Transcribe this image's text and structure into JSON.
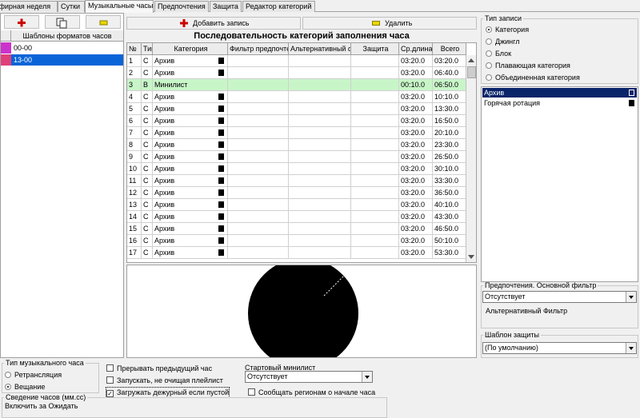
{
  "tabs": [
    {
      "label": "Эфирная неделя"
    },
    {
      "label": "Сутки"
    },
    {
      "label": "Музыкальные часы"
    },
    {
      "label": "Предпочтения"
    },
    {
      "label": "Защита"
    },
    {
      "label": "Редактор категорий"
    }
  ],
  "left": {
    "header": "Шаблоны форматов часов",
    "rows": [
      {
        "label": "00-00",
        "color": "#cc33cc"
      },
      {
        "label": "13-00",
        "color": "#e0407a"
      }
    ]
  },
  "center": {
    "add_label": "Добавить запись",
    "del_label": "Удалить",
    "title": "Последовательность категорий заполнения часа",
    "columns": [
      "№",
      "Тип",
      "Категория",
      "Фильтр предпочтения",
      "Альтернативный ф",
      "Защита",
      "Ср.длина",
      "Всего"
    ],
    "rows": [
      {
        "n": "1",
        "t": "C",
        "cat": "Архив",
        "avg": "03:20.0",
        "tot": "03:20.0"
      },
      {
        "n": "2",
        "t": "C",
        "cat": "Архив",
        "avg": "03:20.0",
        "tot": "06:40.0"
      },
      {
        "n": "3",
        "t": "B",
        "cat": "Минилист",
        "avg": "00:10.0",
        "tot": "06:50.0"
      },
      {
        "n": "4",
        "t": "C",
        "cat": "Архив",
        "avg": "03:20.0",
        "tot": "10:10.0"
      },
      {
        "n": "5",
        "t": "C",
        "cat": "Архив",
        "avg": "03:20.0",
        "tot": "13:30.0"
      },
      {
        "n": "6",
        "t": "C",
        "cat": "Архив",
        "avg": "03:20.0",
        "tot": "16:50.0"
      },
      {
        "n": "7",
        "t": "C",
        "cat": "Архив",
        "avg": "03:20.0",
        "tot": "20:10.0"
      },
      {
        "n": "8",
        "t": "C",
        "cat": "Архив",
        "avg": "03:20.0",
        "tot": "23:30.0"
      },
      {
        "n": "9",
        "t": "C",
        "cat": "Архив",
        "avg": "03:20.0",
        "tot": "26:50.0"
      },
      {
        "n": "10",
        "t": "C",
        "cat": "Архив",
        "avg": "03:20.0",
        "tot": "30:10.0"
      },
      {
        "n": "11",
        "t": "C",
        "cat": "Архив",
        "avg": "03:20.0",
        "tot": "33:30.0"
      },
      {
        "n": "12",
        "t": "C",
        "cat": "Архив",
        "avg": "03:20.0",
        "tot": "36:50.0"
      },
      {
        "n": "13",
        "t": "C",
        "cat": "Архив",
        "avg": "03:20.0",
        "tot": "40:10.0"
      },
      {
        "n": "14",
        "t": "C",
        "cat": "Архив",
        "avg": "03:20.0",
        "tot": "43:30.0"
      },
      {
        "n": "15",
        "t": "C",
        "cat": "Архив",
        "avg": "03:20.0",
        "tot": "46:50.0"
      },
      {
        "n": "16",
        "t": "C",
        "cat": "Архив",
        "avg": "03:20.0",
        "tot": "50:10.0"
      },
      {
        "n": "17",
        "t": "C",
        "cat": "Архив",
        "avg": "03:20.0",
        "tot": "53:30.0"
      }
    ]
  },
  "right": {
    "record_type_legend": "Тип записи",
    "record_types": [
      {
        "label": "Категория",
        "selected": true
      },
      {
        "label": "Джингл",
        "selected": false
      },
      {
        "label": "Блок",
        "selected": false
      },
      {
        "label": "Плавающая категория",
        "selected": false
      },
      {
        "label": "Объединенная категория",
        "selected": false
      }
    ],
    "categories": [
      {
        "label": "Архив",
        "selected": true
      },
      {
        "label": "Горячая ротация",
        "selected": false
      }
    ],
    "pref_legend": "Предпочтения. Основной фильтр",
    "pref_value": "Отсутствует",
    "alt_filter_label": "Альтернативный Фильтр",
    "protect_legend": "Шаблон защиты",
    "protect_value": "(По умолчанию)"
  },
  "bottom": {
    "hour_type_legend": "Тип музыкального часа",
    "hour_types": [
      {
        "label": "Ретрансляция",
        "selected": false
      },
      {
        "label": "Вещание",
        "selected": true
      }
    ],
    "chk_interrupt": "Прерывать предыдущий час",
    "chk_no_clear": "Запускать, не очищая плейлист",
    "chk_load_duty": "Загружать дежурный если пустой",
    "chk_load_duty_checked": true,
    "start_minilist_label": "Стартовый минилист",
    "start_minilist_value": "Отсутствует",
    "chk_notify": "Сообщать регионам о начале часа",
    "mixing_label": "Сведение часов (мм.сс)",
    "mixing_partial": "Включить за    Ожидать"
  },
  "colors": {
    "selection": "#0a64d8",
    "highlight_row": "#c8f5c8",
    "list_selection": "#0a246a",
    "plus_icon": "#cc0000",
    "minus_icon": "#e8d800"
  }
}
